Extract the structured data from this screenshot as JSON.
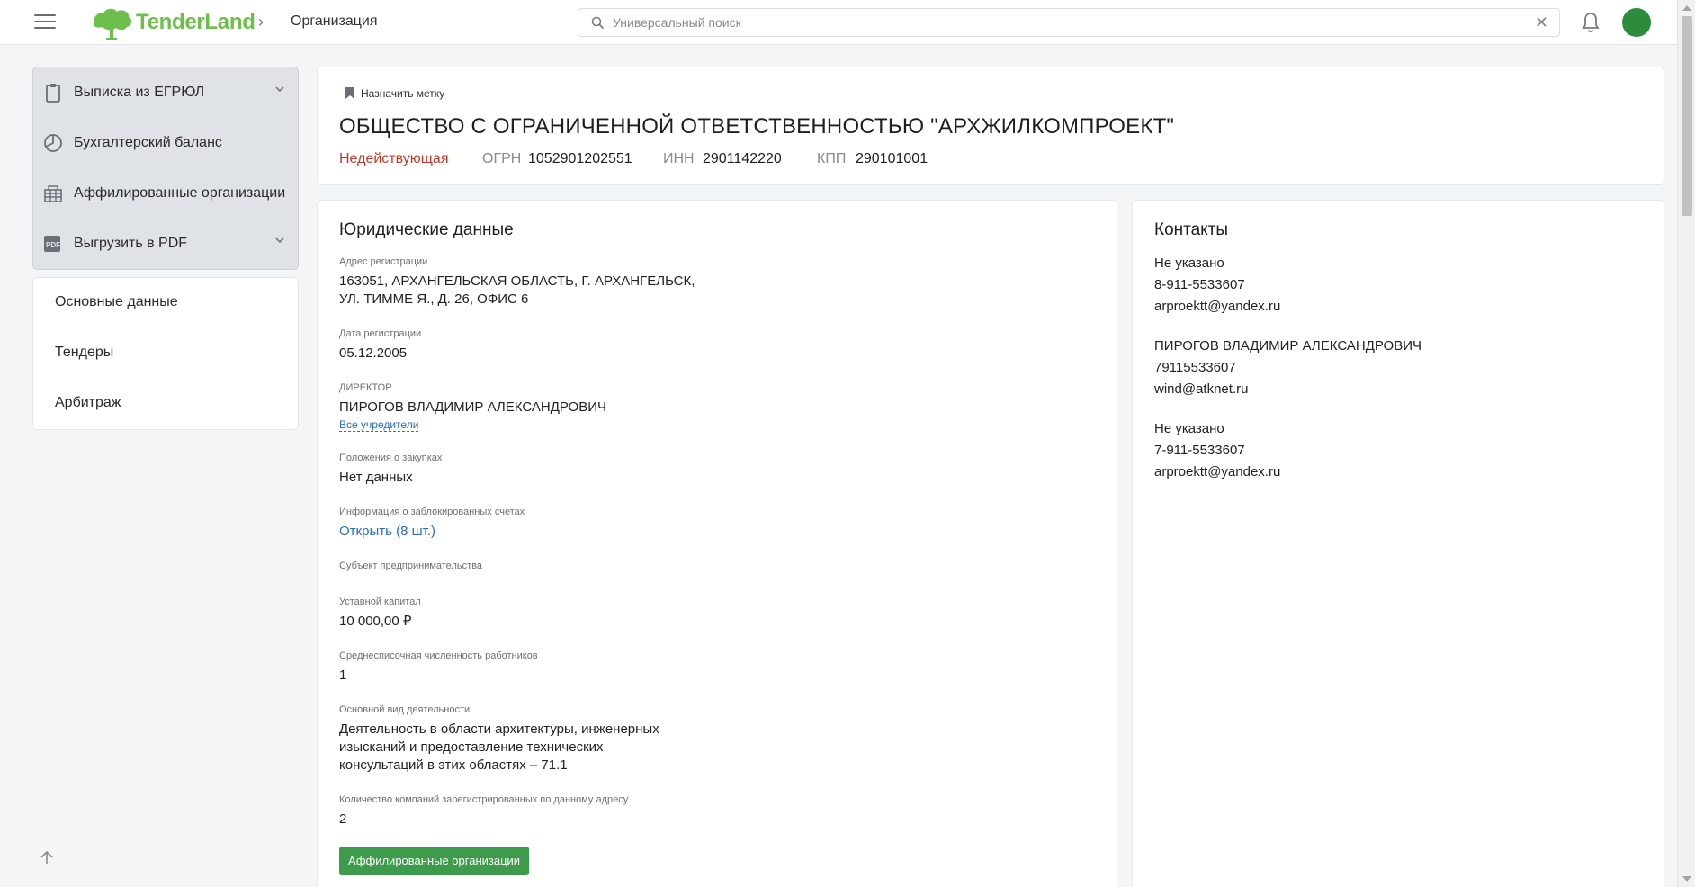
{
  "header": {
    "logo_text": "TenderLand",
    "breadcrumb": "Организация",
    "search": {
      "placeholder": "Универсальный поиск",
      "value": ""
    }
  },
  "sidebar": {
    "menu": [
      {
        "label": "Выписка из ЕГРЮЛ",
        "icon": "clipboard-icon",
        "has_dropdown": true
      },
      {
        "label": "Бухгалтерский баланс",
        "icon": "pie-chart-icon",
        "has_dropdown": false
      },
      {
        "label": "Аффилированные организации",
        "icon": "buildings-icon",
        "has_dropdown": false
      },
      {
        "label": "Выгрузить в PDF",
        "icon": "pdf-icon",
        "has_dropdown": true
      }
    ],
    "nav": [
      "Основные данные",
      "Тендеры",
      "Арбитраж"
    ]
  },
  "company": {
    "tag_label": "Назначить метку",
    "title": "ОБЩЕСТВО С ОГРАНИЧЕННОЙ ОТВЕТСТВЕННОСТЬЮ \"АРХЖИЛКОМПРОЕКТ\"",
    "status": "Недействующая",
    "ogrn_label": "ОГРН",
    "ogrn": "1052901202551",
    "inn_label": "ИНН",
    "inn": "2901142220",
    "kpp_label": "КПП",
    "kpp": "290101001"
  },
  "legal": {
    "title": "Юридические данные",
    "address_label": "Адрес регистрации",
    "address_line1": "163051, АРХАНГЕЛЬСКАЯ ОБЛАСТЬ, Г. АРХАНГЕЛЬСК,",
    "address_line2": "УЛ. ТИММЕ Я., Д. 26, ОФИС 6",
    "reg_date_label": "Дата регистрации",
    "reg_date": "05.12.2005",
    "director_label": "ДИРЕКТОР",
    "director": "ПИРОГОВ ВЛАДИМИР АЛЕКСАНДРОВИЧ",
    "founders_link": "Все учредители",
    "procurement_label": "Положения о закупках",
    "procurement": "Нет данных",
    "blocked_label": "Информация о заблокированных счетах",
    "blocked_link": "Открыть (8 шт.)",
    "entrepreneur_label": "Субъект предпринимательства",
    "capital_label": "Уставной капитал",
    "capital": "10 000,00 ₽",
    "employees_label": "Среднесписочная численность работников",
    "employees": "1",
    "activity_label": "Основной вид деятельности",
    "activity_line1": "Деятельность в области архитектуры, инженерных",
    "activity_line2": "изысканий и предоставление технических",
    "activity_line3": "консультаций в этих областях – 71.1",
    "companies_label": "Количество компаний зарегистрированных по данному адресу",
    "companies_count": "2",
    "affiliated_button": "Аффилированные организации"
  },
  "contacts": {
    "title": "Контакты",
    "groups": [
      {
        "name": "Не указано",
        "phone": "8-911-5533607",
        "email": "arproektt@yandex.ru"
      },
      {
        "name": "ПИРОГОВ ВЛАДИМИР АЛЕКСАНДРОВИЧ",
        "phone": "79115533607",
        "email": "wind@atknet.ru"
      },
      {
        "name": "Не указано",
        "phone": "7-911-5533607",
        "email": "arproektt@yandex.ru"
      }
    ]
  },
  "colors": {
    "brand_green": "#6cbf4a",
    "status_red": "#c0392b",
    "link_blue": "#2b6cc4",
    "button_green": "#3e9b4b"
  }
}
